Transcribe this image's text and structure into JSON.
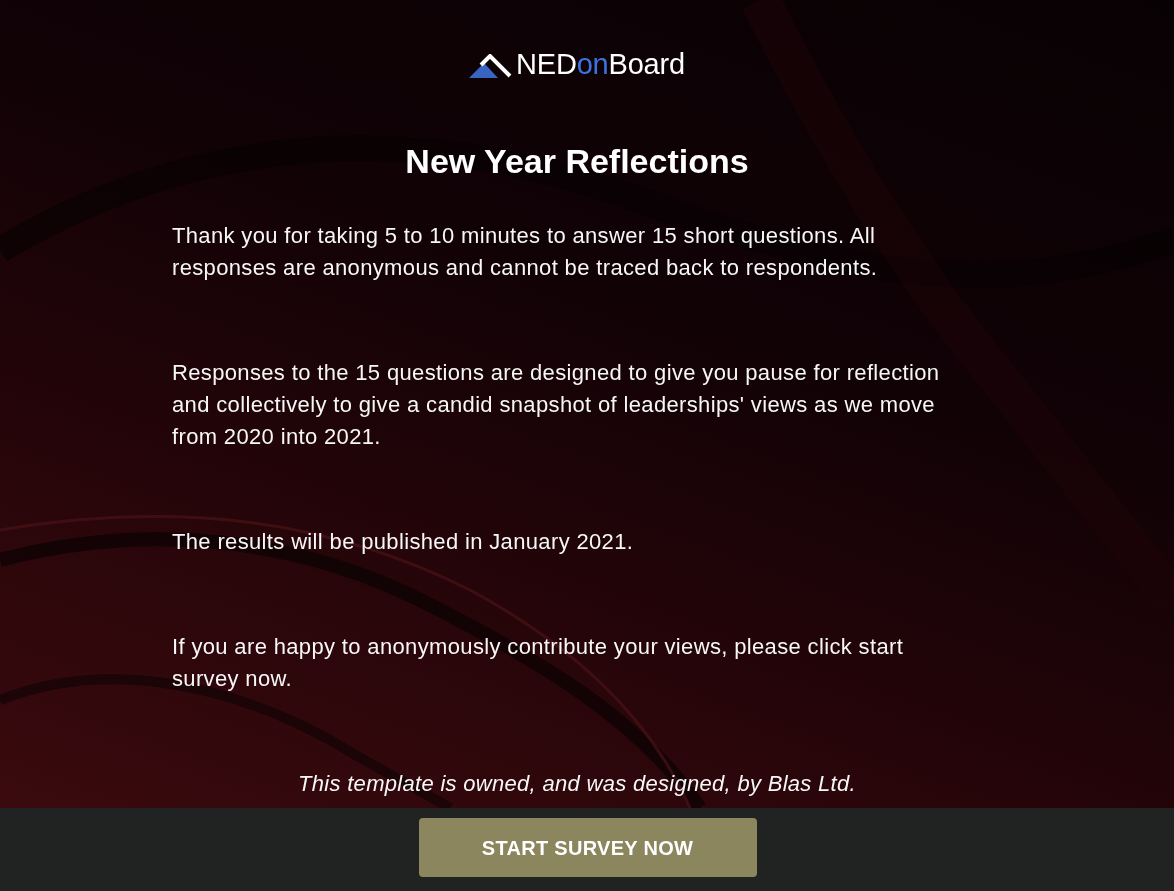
{
  "logo": {
    "parts": [
      {
        "text": "NED",
        "accent": false
      },
      {
        "text": "on",
        "accent": true
      },
      {
        "text": "Board",
        "accent": false
      }
    ]
  },
  "title": "New Year Reflections",
  "paragraphs": [
    "Thank you for taking 5 to 10 minutes to answer 15 short questions. All responses are anonymous and cannot be traced back to respondents.",
    "Responses to the 15 questions are designed to give you pause for reflection and collectively to give a candid snapshot of leaderships' views as we move from 2020 into 2021.",
    "The results will be published in January 2021.",
    "If you are happy to anonymously contribute your views, please click start survey now."
  ],
  "footnote": "This template is owned, and was designed, by Blas Ltd.",
  "action_bar": {
    "button": "START SURVEY NOW"
  }
}
